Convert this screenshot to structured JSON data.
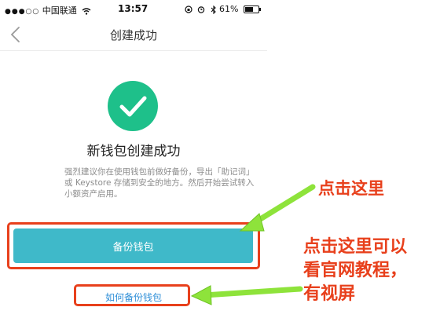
{
  "status_bar": {
    "carrier_dots": "●●●○○",
    "carrier": "中国联通",
    "wifi_icon": "wifi-icon",
    "time": "13:57",
    "battery_percent": "61%",
    "battery_level": 0.61
  },
  "nav": {
    "title": "创建成功",
    "back_icon": "chevron-left-icon"
  },
  "main": {
    "success_icon": "checkmark-circle-icon",
    "success_title": "新钱包创建成功",
    "advice_text": "强烈建议你在使用钱包前做好备份，导出「助记词」或 Keystore 存储到安全的地方。然后开始尝试转入小额资产启用。",
    "backup_button": "备份钱包",
    "how_to_link": "如何备份钱包"
  },
  "annotations": {
    "note_button": "点击这里",
    "note_link_lines": [
      "点击这里可以",
      "看官网教程，",
      "有视屏"
    ],
    "highlight_color": "#e8401c",
    "arrow_color": "#8ee33b"
  },
  "colors": {
    "accent": "#3fb9c9",
    "success": "#1ec08a",
    "link": "#2f8fd8"
  }
}
